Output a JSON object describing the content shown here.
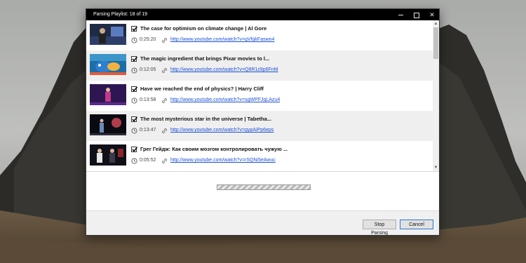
{
  "window": {
    "title": "Parsing Playlist: 18 of 19"
  },
  "list": {
    "items": [
      {
        "checked": true,
        "title": "The case for optimism on climate change | Al Gore",
        "duration": "0:25:20",
        "url": "http://www.youtube.com/watch?v=gVfqkFaswn4"
      },
      {
        "checked": true,
        "title": "The magic ingredient that brings Pixar movies to l...",
        "duration": "0:12:05",
        "url": "http://www.youtube.com/watch?v=Q8R1z9p6FnM"
      },
      {
        "checked": true,
        "title": "Have we reached the end of physics? | Harry Cliff",
        "duration": "0:13:58",
        "url": "http://www.youtube.com/watch?v=sgWPFJqLAzu4"
      },
      {
        "checked": true,
        "title": "The most mysterious star in the universe | Tabetha...",
        "duration": "0:13:47",
        "url": "http://www.youtube.com/watch?v=gypAiPp6eps"
      },
      {
        "checked": true,
        "title": "Грег Гейдж: Как своим мозгом контролировать чужую ...",
        "duration": "0:05:52",
        "url": "http://www.youtube.com/watch?v=rSQNi5eAwuc"
      }
    ]
  },
  "progress": {
    "state": "indeterminate"
  },
  "footer": {
    "stop_label": "Stop Parsing",
    "cancel_label": "Cancel"
  },
  "colors": {
    "title_bar": "#000000",
    "link": "#1a4fd6",
    "row_alt": "#efefef",
    "default_button_border": "#2a78d4"
  }
}
